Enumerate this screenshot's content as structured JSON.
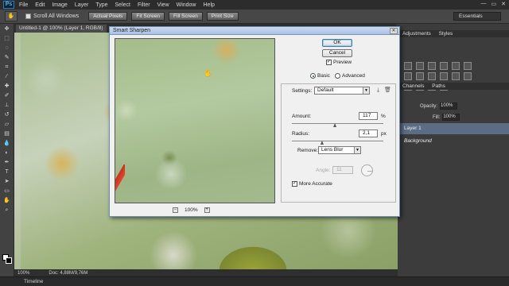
{
  "app": {
    "logo": "Ps",
    "menu": [
      "File",
      "Edit",
      "Image",
      "Layer",
      "Type",
      "Select",
      "Filter",
      "View",
      "Window",
      "Help"
    ],
    "window_controls": [
      "—",
      "▭",
      "✕"
    ]
  },
  "options_bar": {
    "scroll_all_windows": "Scroll All Windows",
    "buttons": [
      "Actual Pixels",
      "Fit Screen",
      "Fill Screen",
      "Print Size"
    ],
    "workspace": "Essentials"
  },
  "document": {
    "tab_title": "Untitled-1 @ 100% (Layer 1, RGB/8)",
    "zoom": "100%",
    "doc_info": "Doc: 4,88M/9,76M"
  },
  "timeline": {
    "label": "Timeline"
  },
  "panels": {
    "top_tabs": [
      "Adjustments",
      "Styles"
    ],
    "layers_tabs": [
      "Channels",
      "Paths"
    ],
    "opacity_label": "Opacity:",
    "opacity_value": "100%",
    "fill_label": "Fill:",
    "fill_value": "100%",
    "layers": [
      {
        "name": "Layer 1",
        "selected": true
      },
      {
        "name": "Background",
        "selected": false
      }
    ]
  },
  "dialog": {
    "title": "Smart Sharpen",
    "close_glyph": "✕",
    "ok": "OK",
    "cancel": "Cancel",
    "preview_label": "Preview",
    "preview_checked": true,
    "mode_basic": "Basic",
    "mode_advanced": "Advanced",
    "mode_selected": "Basic",
    "settings_label": "Settings:",
    "settings_value": "Default",
    "amount_label": "Amount:",
    "amount_value": "117",
    "amount_unit": "%",
    "amount_level": 0.47,
    "radius_label": "Radius:",
    "radius_value": "2,1",
    "radius_unit": "px",
    "radius_level": 0.33,
    "remove_label": "Remove:",
    "remove_value": "Lens Blur",
    "angle_label": "Angle:",
    "angle_value": "11",
    "more_accurate_label": "More Accurate",
    "more_accurate_checked": true,
    "zoom_value": "100%",
    "zoom_minus": "−",
    "zoom_plus": "+"
  }
}
